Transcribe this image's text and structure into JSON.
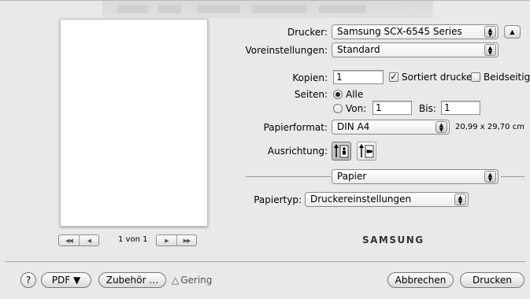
{
  "printer": {
    "label": "Drucker:",
    "value": "Samsung SCX-6545 Series",
    "toggle_icon": "triangle-up-icon"
  },
  "presets": {
    "label": "Voreinstellungen:",
    "value": "Standard"
  },
  "copies": {
    "label": "Kopien:",
    "value": "1",
    "collate_label": "Sortiert drucken",
    "collate_checked": true,
    "duplex_label": "Beidseitig",
    "duplex_checked": false
  },
  "pages": {
    "label": "Seiten:",
    "all_label": "Alle",
    "all_selected": true,
    "from_label": "Von:",
    "from_value": "1",
    "to_label": "Bis:",
    "to_value": "1"
  },
  "paper_format": {
    "label": "Papierformat:",
    "value": "DIN A4",
    "dimensions": "20,99 x 29,70 cm"
  },
  "orientation": {
    "label": "Ausrichtung:",
    "options": [
      "portrait",
      "landscape"
    ],
    "selected": "portrait"
  },
  "panel": {
    "value": "Papier"
  },
  "paper_type": {
    "label": "Papiertyp:",
    "value": "Druckereinstellungen"
  },
  "preview": {
    "page_count": "1 von 1"
  },
  "brand": {
    "logo_text": "SAMSUNG"
  },
  "bottom": {
    "help_label": "?",
    "pdf_label": "PDF ▼",
    "accessories_label": "Zubehör …",
    "supply_label": "Gering",
    "cancel_label": "Abbrechen",
    "print_label": "Drucken"
  },
  "colors": {
    "dialog_bg": "#e9e9e9",
    "separator": "#9a9a9a"
  }
}
